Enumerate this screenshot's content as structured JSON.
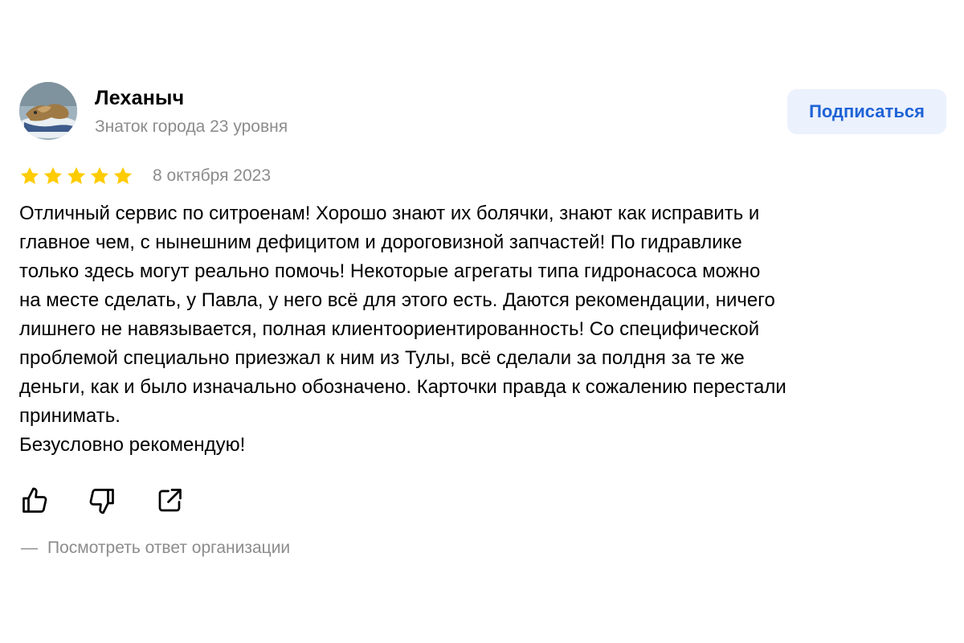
{
  "author": {
    "name": "Леханыч",
    "level": "Знаток города 23 уровня"
  },
  "subscribe_label": "Подписаться",
  "rating": {
    "stars": 5,
    "max": 5,
    "color": "#fc0"
  },
  "date": "8 октября 2023",
  "text": "Отличный сервис по ситроенам! Хорошо знают их болячки, знают как исправить и\nглавное чем, с нынешним дефицитом и дороговизной запчастей! По гидравлике\nтолько здесь могут реально помочь! Некоторые агрегаты типа гидронасоса можно\nна месте сделать, у Павла, у него всё для этого есть. Даются рекомендации, ничего\nлишнего не навязывается, полная клиентоориентированность! Со специфической\nпроблемой специально приезжал к ним из Тулы, всё сделали за полдня за те же\nденьги, как и было изначально обозначено. Карточки правда к сожалению перестали\nпринимать.\nБезусловно рекомендую!",
  "actions": {
    "like_icon": "thumbs-up-icon",
    "dislike_icon": "thumbs-down-icon",
    "share_icon": "share-icon"
  },
  "org_reply": {
    "dash": "—",
    "label": "Посмотреть ответ организации"
  },
  "colors": {
    "accent": "#1f63d6",
    "button_bg": "#ebf1fd",
    "muted_text": "#8c8c8c",
    "star": "#fc0"
  }
}
